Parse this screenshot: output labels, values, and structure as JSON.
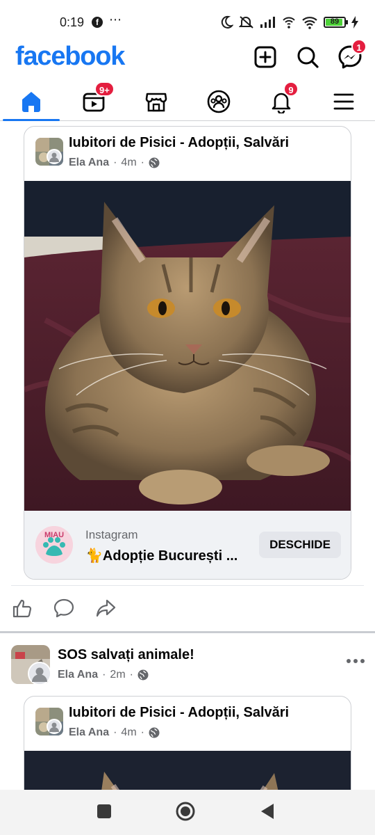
{
  "status_bar": {
    "time": "0:19",
    "dots": "⋯",
    "battery": "89"
  },
  "header": {
    "logo": "facebook",
    "messenger_badge": "1"
  },
  "tabs": {
    "video_badge": "9+",
    "notifications_badge": "9"
  },
  "post1": {
    "group_name": "Iubitori de Pisici - Adopții, Salvări",
    "author": "Ela Ana",
    "time": "4m",
    "link": {
      "source": "Instagram",
      "title": "🐈Adopție București ...",
      "button": "DESCHIDE"
    }
  },
  "post2": {
    "page_name": "SOS salvați animale!",
    "author": "Ela Ana",
    "time": "2m",
    "shared": {
      "group_name": "Iubitori de Pisici - Adopții, Salvări",
      "author": "Ela Ana",
      "time": "4m"
    }
  },
  "colors": {
    "brand": "#1877f2",
    "badge": "#e41e3f",
    "meta": "#65676b"
  },
  "icons": [
    "create-post-icon",
    "search-icon",
    "messenger-icon",
    "home-icon",
    "video-icon",
    "marketplace-icon",
    "groups-icon",
    "bell-icon",
    "menu-icon",
    "like-icon",
    "comment-icon",
    "share-icon",
    "globe-icon",
    "more-icon",
    "nav-recents-icon",
    "nav-home-icon",
    "nav-back-icon"
  ]
}
